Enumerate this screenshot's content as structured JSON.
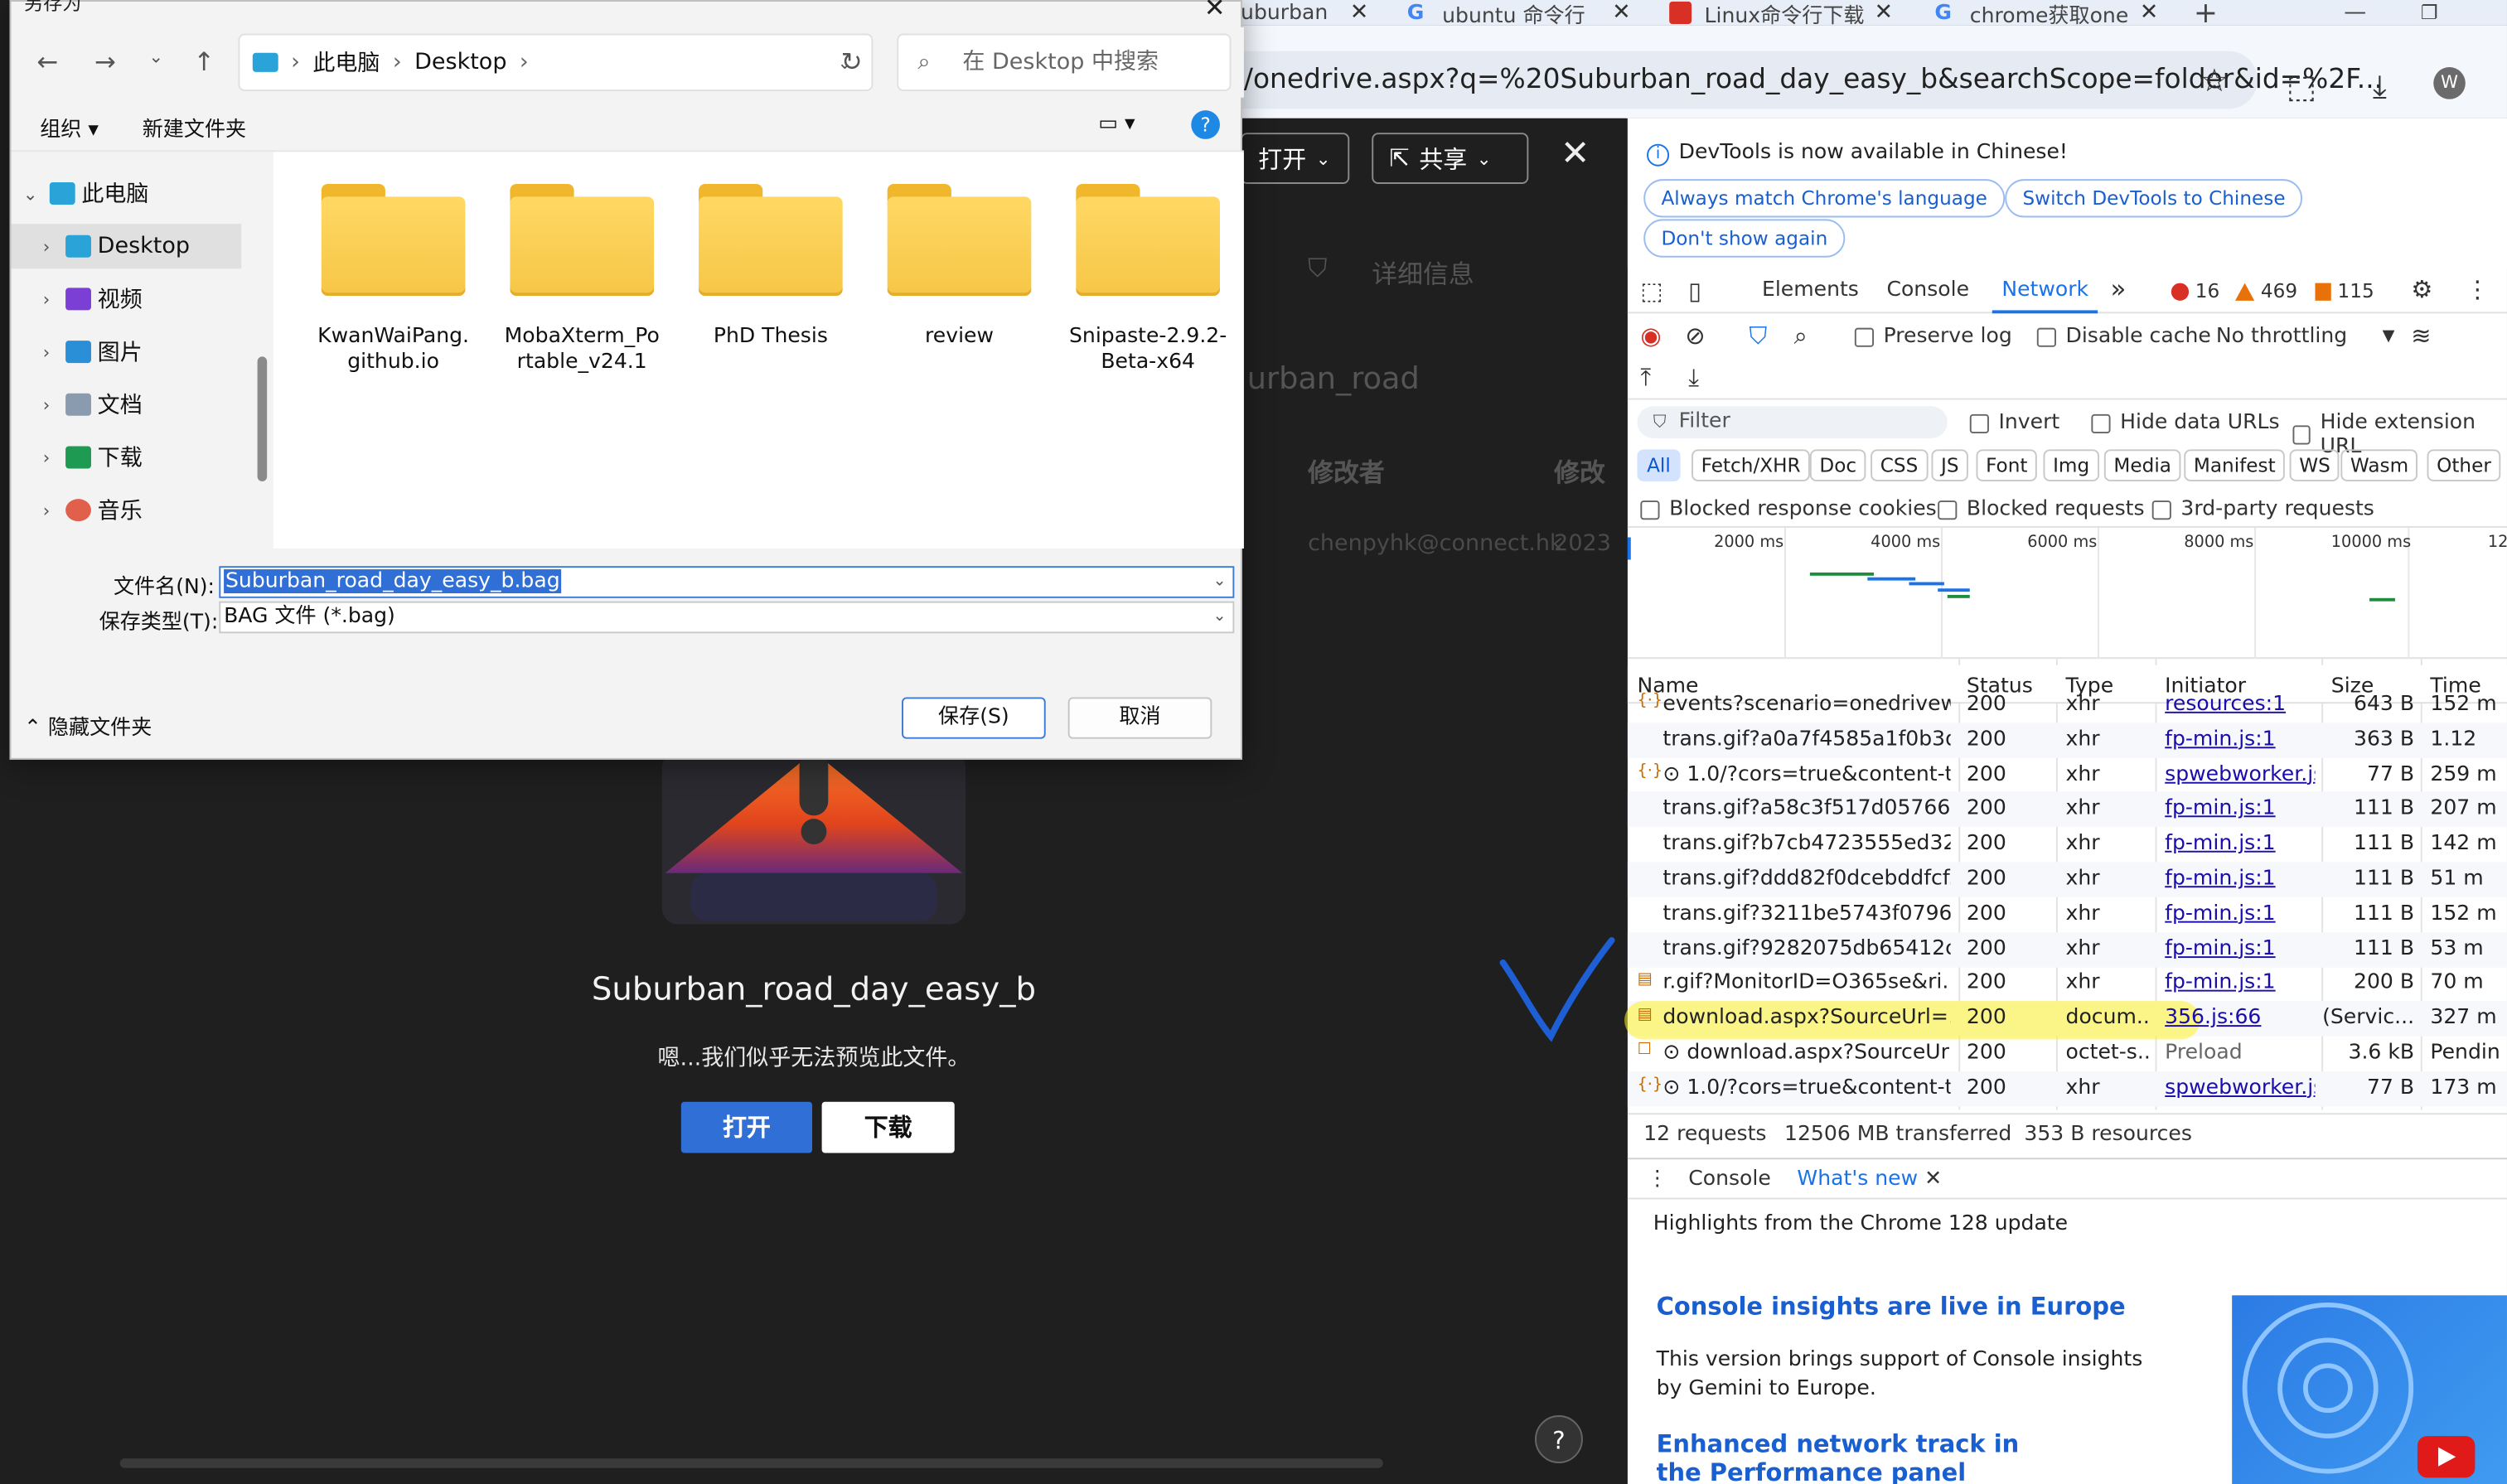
{
  "browser": {
    "tabs": [
      {
        "title": "uburban",
        "close": "✕",
        "favicon_color": "#2f6fd6"
      },
      {
        "title": "ubuntu 命令行",
        "close": "✕",
        "favicon": "G"
      },
      {
        "title": "Linux命令行下载",
        "close": "✕",
        "favicon_color": "#d93025"
      },
      {
        "title": "chrome获取one",
        "close": "✕",
        "favicon": "G"
      }
    ],
    "new_tab": "+",
    "url": "/onedrive.aspx?q=%20Suburban_road_day_easy_b&searchScope=folder&id=%2F...",
    "avatar": "W"
  },
  "onedrive": {
    "open_label": "打开",
    "share_label": "共享",
    "details_label": "详细信息",
    "folder_title_fragment": "urban_road",
    "col_modifier": "修改者",
    "col_modified": "修改",
    "row_user": "chenpyhk@connect.hk",
    "row_year": "2023",
    "preview_title": "Suburban_road_day_easy_b",
    "preview_message": "嗯...我们似乎无法预览此文件。",
    "btn_open": "打开",
    "btn_download": "下载",
    "help": "?"
  },
  "dialog": {
    "title": "另存为",
    "breadcrumb": [
      "此电脑",
      "Desktop"
    ],
    "search_placeholder": "在 Desktop 中搜索",
    "cmd_organize": "组织",
    "cmd_new_folder": "新建文件夹",
    "help": "?",
    "sidebar": [
      {
        "label": "此电脑",
        "icon": "computer-icon",
        "color": "#2aa3d8"
      },
      {
        "label": "Desktop",
        "icon": "desktop-icon",
        "color": "#2aa3d8"
      },
      {
        "label": "视频",
        "icon": "video-icon",
        "color": "#7b3fd6"
      },
      {
        "label": "图片",
        "icon": "picture-icon",
        "color": "#2b8fd8"
      },
      {
        "label": "文档",
        "icon": "document-icon",
        "color": "#8a9bb0"
      },
      {
        "label": "下载",
        "icon": "download-icon",
        "color": "#1f9a52"
      },
      {
        "label": "音乐",
        "icon": "music-icon",
        "color": "#e0604c"
      }
    ],
    "folders": [
      "KwanWaiPang.github.io",
      "MobaXterm_Portable_v24.1",
      "PhD Thesis",
      "review",
      "Snipaste-2.9.2-Beta-x64"
    ],
    "filename_label": "文件名(N):",
    "filename_value": "Suburban_road_day_easy_b.bag",
    "filetype_label": "保存类型(T):",
    "filetype_value": "BAG 文件 (*.bag)",
    "hide_folders": "隐藏文件夹",
    "save": "保存(S)",
    "cancel": "取消"
  },
  "devtools": {
    "info_message": "DevTools is now available in Chinese!",
    "chip_match": "Always match Chrome's language",
    "chip_switch": "Switch DevTools to Chinese",
    "chip_dismiss": "Don't show again",
    "tabs": [
      "Elements",
      "Console",
      "Network"
    ],
    "more_tabs": "»",
    "errors": "16",
    "warnings": "469",
    "issues": "115",
    "preserve_log": "Preserve log",
    "disable_cache": "Disable cache",
    "throttling": "No throttling",
    "filter_placeholder": "Filter",
    "invert": "Invert",
    "hide_data_urls": "Hide data URLs",
    "hide_extension_urls": "Hide extension URL",
    "type_filters": [
      "All",
      "Fetch/XHR",
      "Doc",
      "CSS",
      "JS",
      "Font",
      "Img",
      "Media",
      "Manifest",
      "WS",
      "Wasm",
      "Other"
    ],
    "blocked_cookies": "Blocked response cookies",
    "blocked_requests": "Blocked requests",
    "third_party": "3rd-party requests",
    "timeline_ticks": [
      "2000 ms",
      "4000 ms",
      "6000 ms",
      "8000 ms",
      "10000 ms",
      "12"
    ],
    "columns": [
      "Name",
      "Status",
      "Type",
      "Initiator",
      "Size",
      "Time"
    ],
    "rows": [
      {
        "name": "events?scenario=onedrivew...",
        "status": "200",
        "type": "xhr",
        "initiator": "resources:1",
        "size": "643 B",
        "time": "152 m"
      },
      {
        "name": "trans.gif?a0a7f4585a1f0b3d...",
        "status": "200",
        "type": "xhr",
        "initiator": "fp-min.js:1",
        "size": "363 B",
        "time": "1.12"
      },
      {
        "name": "⊙ 1.0/?cors=true&content-t...",
        "status": "200",
        "type": "xhr",
        "initiator": "spwebworker.js:9",
        "size": "77 B",
        "time": "259 m"
      },
      {
        "name": "trans.gif?a58c3f517d057664...",
        "status": "200",
        "type": "xhr",
        "initiator": "fp-min.js:1",
        "size": "111 B",
        "time": "207 m"
      },
      {
        "name": "trans.gif?b7cb4723555ed32...",
        "status": "200",
        "type": "xhr",
        "initiator": "fp-min.js:1",
        "size": "111 B",
        "time": "142 m"
      },
      {
        "name": "trans.gif?ddd82f0dcebddfcf...",
        "status": "200",
        "type": "xhr",
        "initiator": "fp-min.js:1",
        "size": "111 B",
        "time": "51 m"
      },
      {
        "name": "trans.gif?3211be5743f07960...",
        "status": "200",
        "type": "xhr",
        "initiator": "fp-min.js:1",
        "size": "111 B",
        "time": "152 m"
      },
      {
        "name": "trans.gif?9282075db65412c...",
        "status": "200",
        "type": "xhr",
        "initiator": "fp-min.js:1",
        "size": "111 B",
        "time": "53 m"
      },
      {
        "name": "r.gif?MonitorID=O365se&ri...",
        "status": "200",
        "type": "xhr",
        "initiator": "fp-min.js:1",
        "size": "200 B",
        "time": "70 m"
      },
      {
        "name": "download.aspx?SourceUrl=...",
        "status": "200",
        "type": "docum...",
        "initiator": "356.js:66",
        "size": "(Servic...",
        "time": "327 m"
      },
      {
        "name": "⊙ download.aspx?SourceUrl...",
        "status": "200",
        "type": "octet-s...",
        "initiator": "Preload",
        "size": "3.6 kB",
        "time": "Pendin"
      },
      {
        "name": "⊙ 1.0/?cors=true&content-t...",
        "status": "200",
        "type": "xhr",
        "initiator": "spwebworker.js:9",
        "size": "77 B",
        "time": "173 m"
      }
    ],
    "summary_requests": "12 requests",
    "summary_transferred": "12506 MB transferred",
    "summary_resources": "353 B resources",
    "drawer_console": "Console",
    "drawer_whatsnew": "What's new",
    "highlights": "Highlights from the Chrome 128 update",
    "wn1_title": "Console insights are live in Europe",
    "wn1_body": "This version brings support of Console insights by Gemini to Europe.",
    "wn2_title": "Enhanced network track in the Performance panel"
  },
  "colors": {
    "accent_blue": "#1a73e8",
    "highlight_yellow": "#fff028",
    "checkmark_blue": "#1e5fd6"
  }
}
